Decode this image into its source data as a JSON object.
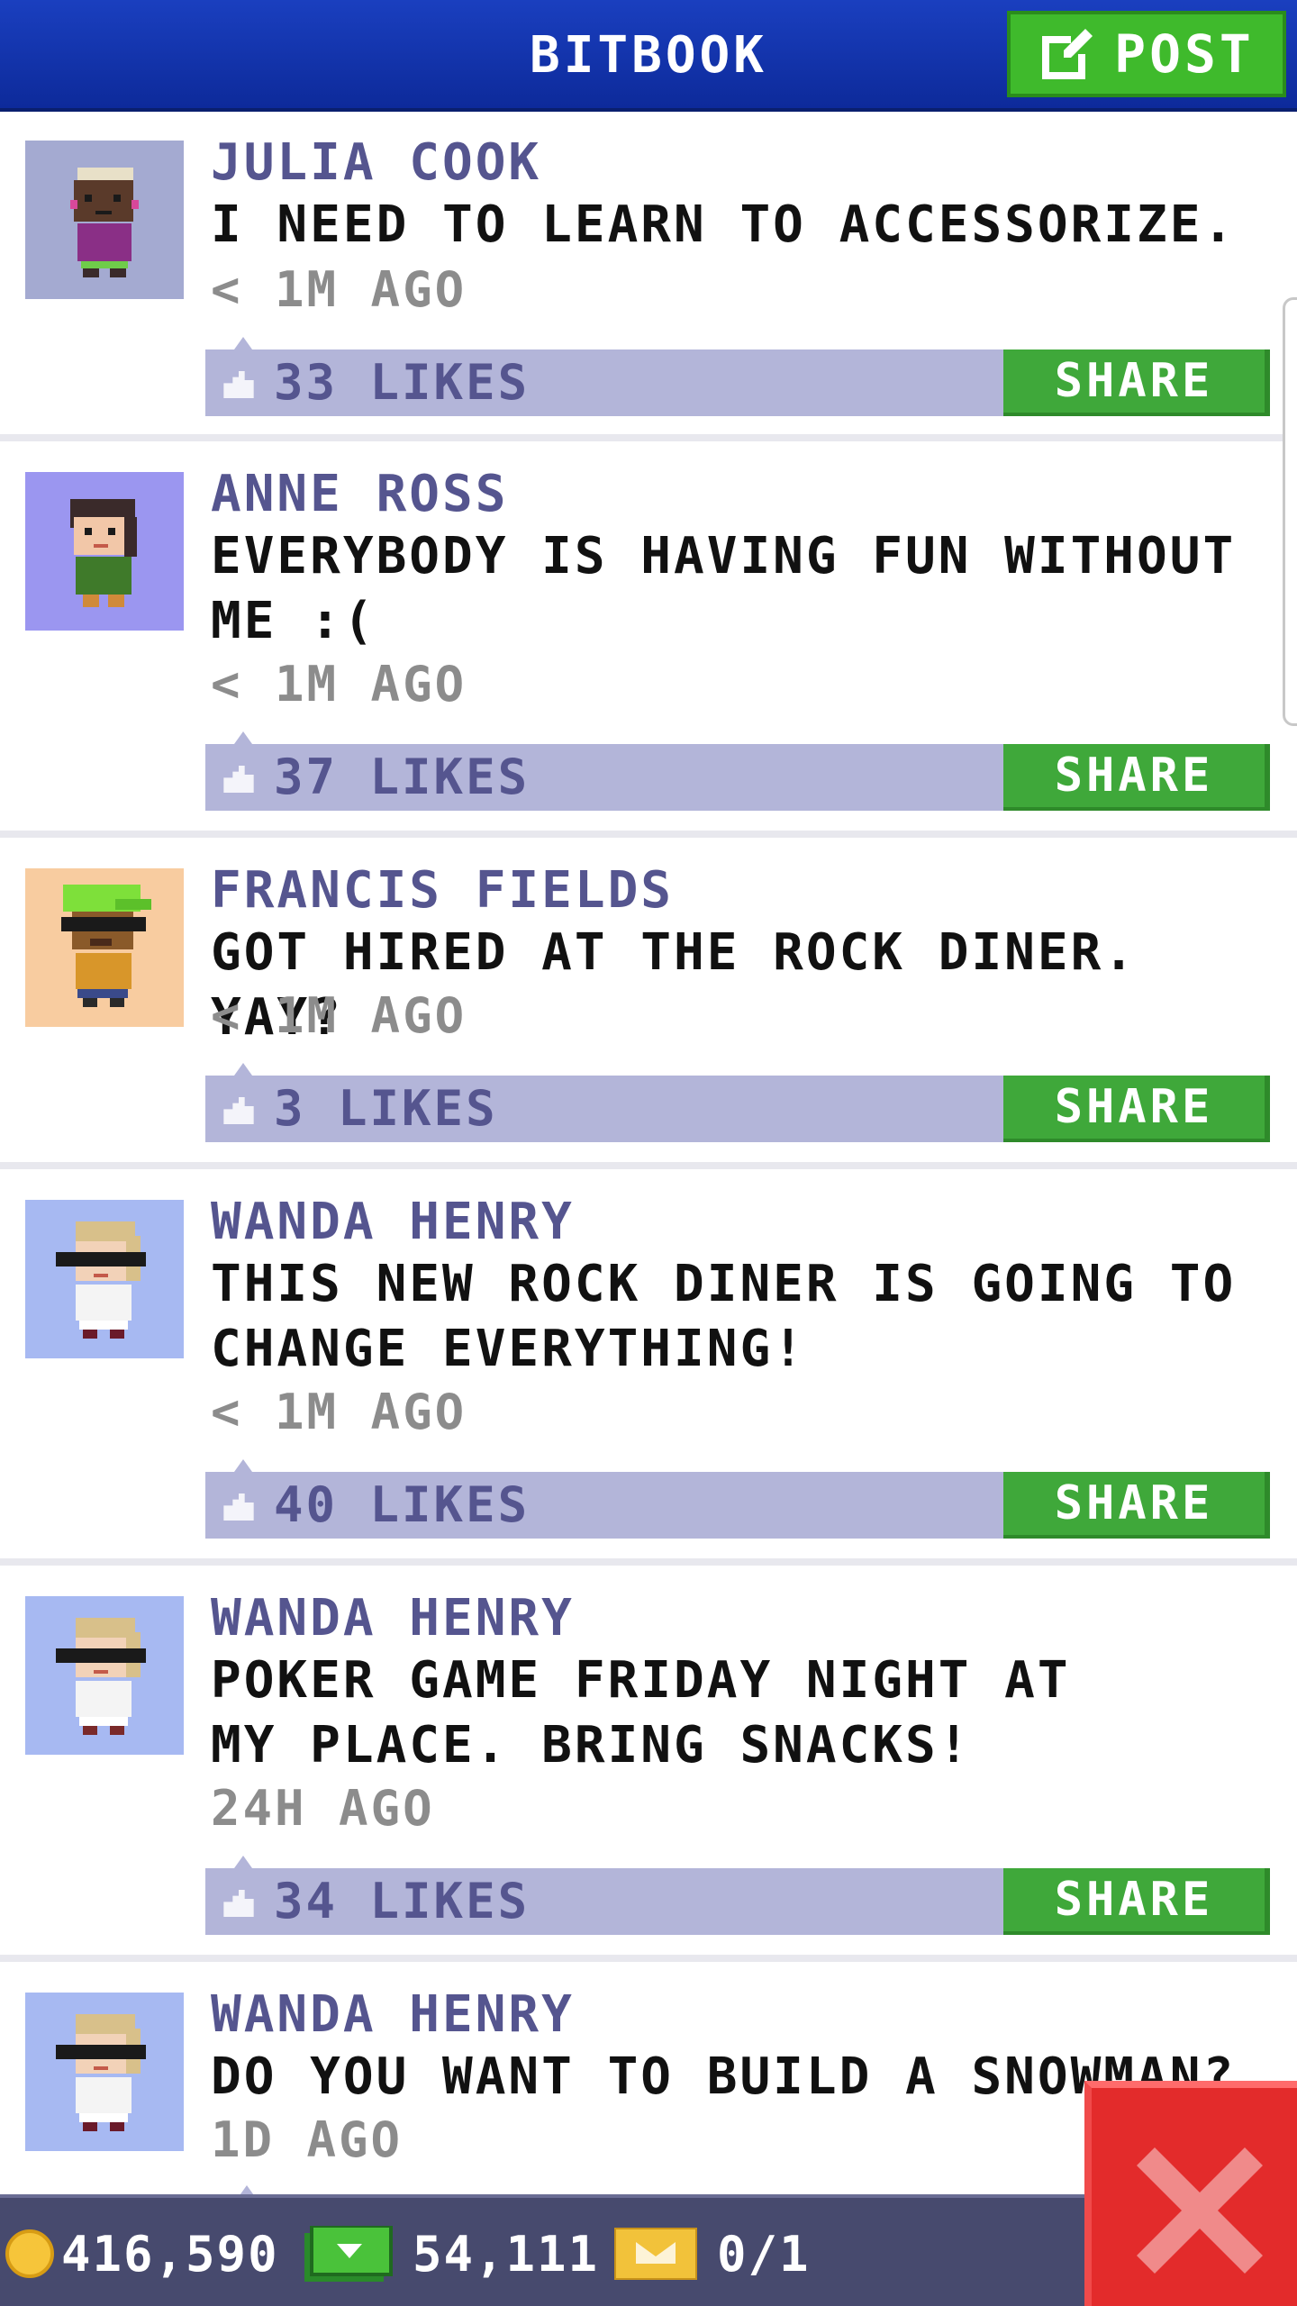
{
  "header": {
    "title": "BITBOOK",
    "post_label": "POST"
  },
  "posts": [
    {
      "author": "JULIA COOK",
      "message": "I NEED TO LEARN TO ACCESSORIZE.",
      "time": "< 1M AGO",
      "likes": "33 LIKES",
      "share": "SHARE",
      "avatar_bg": "#a4aad1"
    },
    {
      "author": "ANNE ROSS",
      "message": "EVERYBODY IS HAVING FUN WITHOUT ME :(",
      "time": "< 1M AGO",
      "likes": "37 LIKES",
      "share": "SHARE",
      "avatar_bg": "#9b96f0"
    },
    {
      "author": "FRANCIS FIELDS",
      "message": "GOT HIRED AT THE ROCK DINER. YAY?",
      "time": "< 1M AGO",
      "likes": "3 LIKES",
      "share": "SHARE",
      "avatar_bg": "#f8cca0"
    },
    {
      "author": "WANDA HENRY",
      "message": "THIS NEW ROCK DINER IS GOING TO CHANGE EVERYTHING!",
      "time": "< 1M AGO",
      "likes": "40 LIKES",
      "share": "SHARE",
      "avatar_bg": "#a7b9f2"
    },
    {
      "author": "WANDA HENRY",
      "message": "POKER GAME FRIDAY NIGHT AT MY PLACE. BRING SNACKS!",
      "time": "24H AGO",
      "likes": "34 LIKES",
      "share": "SHARE",
      "avatar_bg": "#a7b9f2"
    },
    {
      "author": "WANDA HENRY",
      "message": "DO YOU WANT TO BUILD A SNOWMAN?",
      "time": "1D AGO",
      "likes": "",
      "share": "",
      "avatar_bg": "#a7b9f2"
    }
  ],
  "bottom_bar": {
    "coins": "416,590",
    "bux": "54,111",
    "tickets": "0/1"
  },
  "colors": {
    "header": "#1a3fbf",
    "post_button": "#3fba2c",
    "share_button": "#3fa83a",
    "likes_bar": "#b3b5d9",
    "author": "#55558f",
    "close": "#e32b2b"
  },
  "icons": [
    "post-edit-icon",
    "like-icon",
    "coin-icon",
    "cash-icon",
    "ticket-icon",
    "close-icon"
  ]
}
